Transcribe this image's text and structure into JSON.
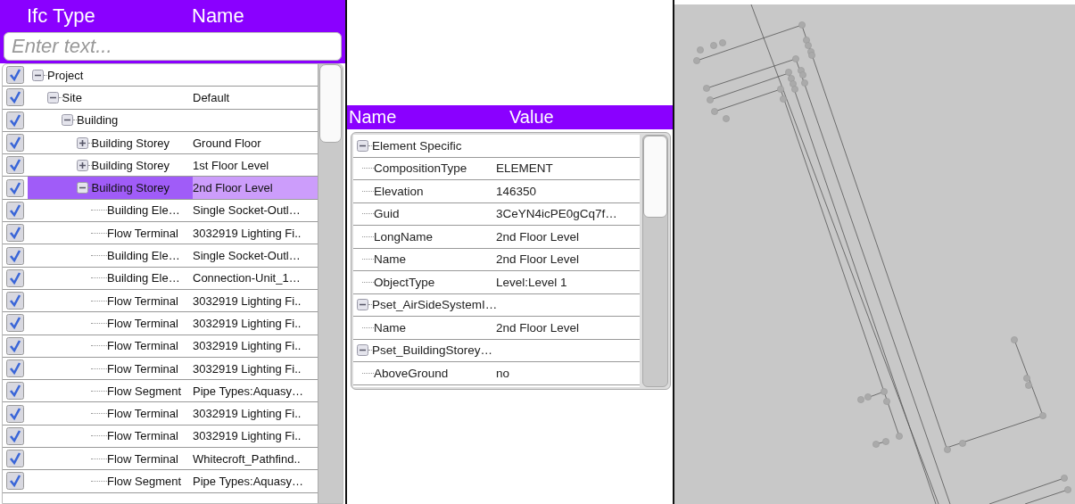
{
  "tree_header": {
    "columns": [
      "Ifc Type",
      "Name"
    ]
  },
  "search": {
    "placeholder": "Enter text..."
  },
  "tree": [
    {
      "ifc_type": "Project",
      "checked": true,
      "selected": false,
      "expanded": true,
      "children": [
        {
          "ifc_type": "Site",
          "name": "Default",
          "checked": true,
          "selected": false,
          "expanded": true,
          "children": [
            {
              "ifc_type": "Building",
              "checked": true,
              "selected": false,
              "expanded": true,
              "children": [
                {
                  "ifc_type": "Building Storey",
                  "name": "Ground Floor",
                  "checked": true,
                  "selected": false,
                  "expanded": false
                },
                {
                  "ifc_type": "Building Storey",
                  "name": "1st Floor Level",
                  "checked": true,
                  "selected": false,
                  "expanded": false
                },
                {
                  "ifc_type": "Building Storey",
                  "name": "2nd Floor Level",
                  "checked": true,
                  "selected": true,
                  "expanded": true,
                  "children": [
                    {
                      "ifc_type": "Building Ele…",
                      "name": "Single Socket-Outl…",
                      "checked": true,
                      "selected": false
                    },
                    {
                      "ifc_type": "Flow Terminal",
                      "name": "3032919 Lighting Fi..",
                      "checked": true,
                      "selected": false
                    },
                    {
                      "ifc_type": "Building Ele…",
                      "name": "Single Socket-Outl…",
                      "checked": true,
                      "selected": false
                    },
                    {
                      "ifc_type": "Building Ele…",
                      "name": "Connection-Unit_1…",
                      "checked": true,
                      "selected": false
                    },
                    {
                      "ifc_type": "Flow Terminal",
                      "name": "3032919 Lighting Fi..",
                      "checked": true,
                      "selected": false
                    },
                    {
                      "ifc_type": "Flow Terminal",
                      "name": "3032919 Lighting Fi..",
                      "checked": true,
                      "selected": false
                    },
                    {
                      "ifc_type": "Flow Terminal",
                      "name": "3032919 Lighting Fi..",
                      "checked": true,
                      "selected": false
                    },
                    {
                      "ifc_type": "Flow Terminal",
                      "name": "3032919 Lighting Fi..",
                      "checked": true,
                      "selected": false
                    },
                    {
                      "ifc_type": "Flow Segment",
                      "name": "Pipe Types:Aquasy…",
                      "checked": true,
                      "selected": false
                    },
                    {
                      "ifc_type": "Flow Terminal",
                      "name": "3032919 Lighting Fi..",
                      "checked": true,
                      "selected": false
                    },
                    {
                      "ifc_type": "Flow Terminal",
                      "name": "3032919 Lighting Fi..",
                      "checked": true,
                      "selected": false
                    },
                    {
                      "ifc_type": "Flow Terminal",
                      "name": "Whitecroft_Pathfind..",
                      "checked": true,
                      "selected": false
                    },
                    {
                      "ifc_type": "Flow Segment",
                      "name": "Pipe Types:Aquasy…",
                      "checked": true,
                      "selected": false
                    }
                  ]
                }
              ]
            }
          ]
        }
      ]
    }
  ],
  "properties_header": {
    "columns": [
      "Name",
      "Value"
    ]
  },
  "properties": [
    {
      "group": "Element Specific",
      "expanded": true,
      "items": [
        {
          "name": "CompositionType",
          "value": "ELEMENT"
        },
        {
          "name": "Elevation",
          "value": "146350"
        },
        {
          "name": "Guid",
          "value": "3CeYN4icPE0gCq7f…"
        },
        {
          "name": "LongName",
          "value": "2nd Floor Level"
        },
        {
          "name": "Name",
          "value": "2nd Floor Level"
        },
        {
          "name": "ObjectType",
          "value": "Level:Level 1"
        }
      ]
    },
    {
      "group": "Pset_AirSideSystemI…",
      "expanded": true,
      "items": [
        {
          "name": "Name",
          "value": "2nd Floor Level"
        }
      ]
    },
    {
      "group": "Pset_BuildingStorey…",
      "expanded": true,
      "items": [
        {
          "name": "AboveGround",
          "value": "no"
        }
      ]
    }
  ]
}
